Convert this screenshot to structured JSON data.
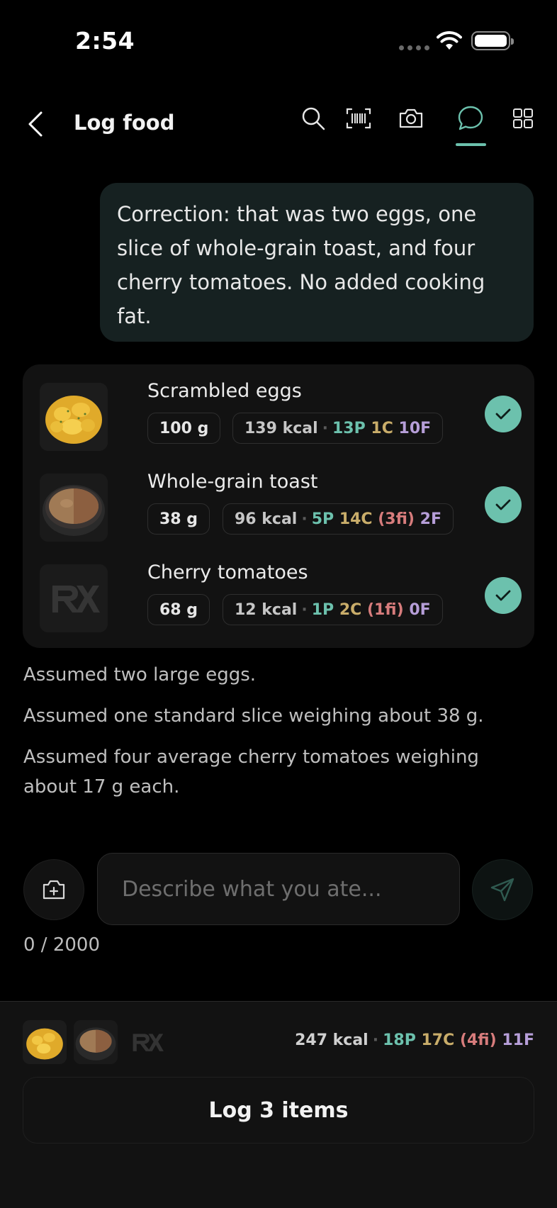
{
  "status_bar": {
    "time": "2:54"
  },
  "header": {
    "title": "Log food",
    "icons": [
      "back-chevron-icon",
      "search-icon",
      "barcode-icon",
      "camera-icon",
      "chat-bubble-icon",
      "grid-icon"
    ],
    "active_tab": "chat"
  },
  "conversation": {
    "user_message": "Correction: that was two eggs, one slice of whole-grain toast, and four cherry tomatoes. No added cooking fat."
  },
  "food_items": [
    {
      "name": "Scrambled eggs",
      "weight": "100 g",
      "kcal": "139 kcal",
      "protein": "13P",
      "carbs": "1C",
      "fiber": "",
      "fat": "10F",
      "selected": true,
      "thumb": "scrambled-eggs-image"
    },
    {
      "name": "Whole-grain toast",
      "weight": "38 g",
      "kcal": "96 kcal",
      "protein": "5P",
      "carbs": "14C",
      "fiber": "(3fi)",
      "fat": "2F",
      "selected": true,
      "thumb": "grain-bowl-image"
    },
    {
      "name": "Cherry tomatoes",
      "weight": "68 g",
      "kcal": "12 kcal",
      "protein": "1P",
      "carbs": "2C",
      "fiber": "(1fi)",
      "fat": "0F",
      "selected": true,
      "thumb": "rx-placeholder-logo"
    }
  ],
  "assumptions": [
    "Assumed two large eggs.",
    "Assumed one standard slice weighing about 38 g.",
    "Assumed four average cherry tomatoes weighing about 17 g each."
  ],
  "input": {
    "placeholder": "Describe what you ate...",
    "value": "",
    "char_count": "0 / 2000"
  },
  "summary": {
    "kcal": "247 kcal",
    "protein": "18P",
    "carbs": "17C",
    "fiber": "(4fi)",
    "fat": "11F",
    "log_button": "Log 3 items"
  },
  "colors": {
    "accent": "#6cc1ad",
    "protein": "#6cc1ad",
    "carbs": "#c9ad6a",
    "fiber": "#d77c7c",
    "fat": "#b69ed8",
    "user_bubble": "#162121",
    "card": "#121212"
  }
}
